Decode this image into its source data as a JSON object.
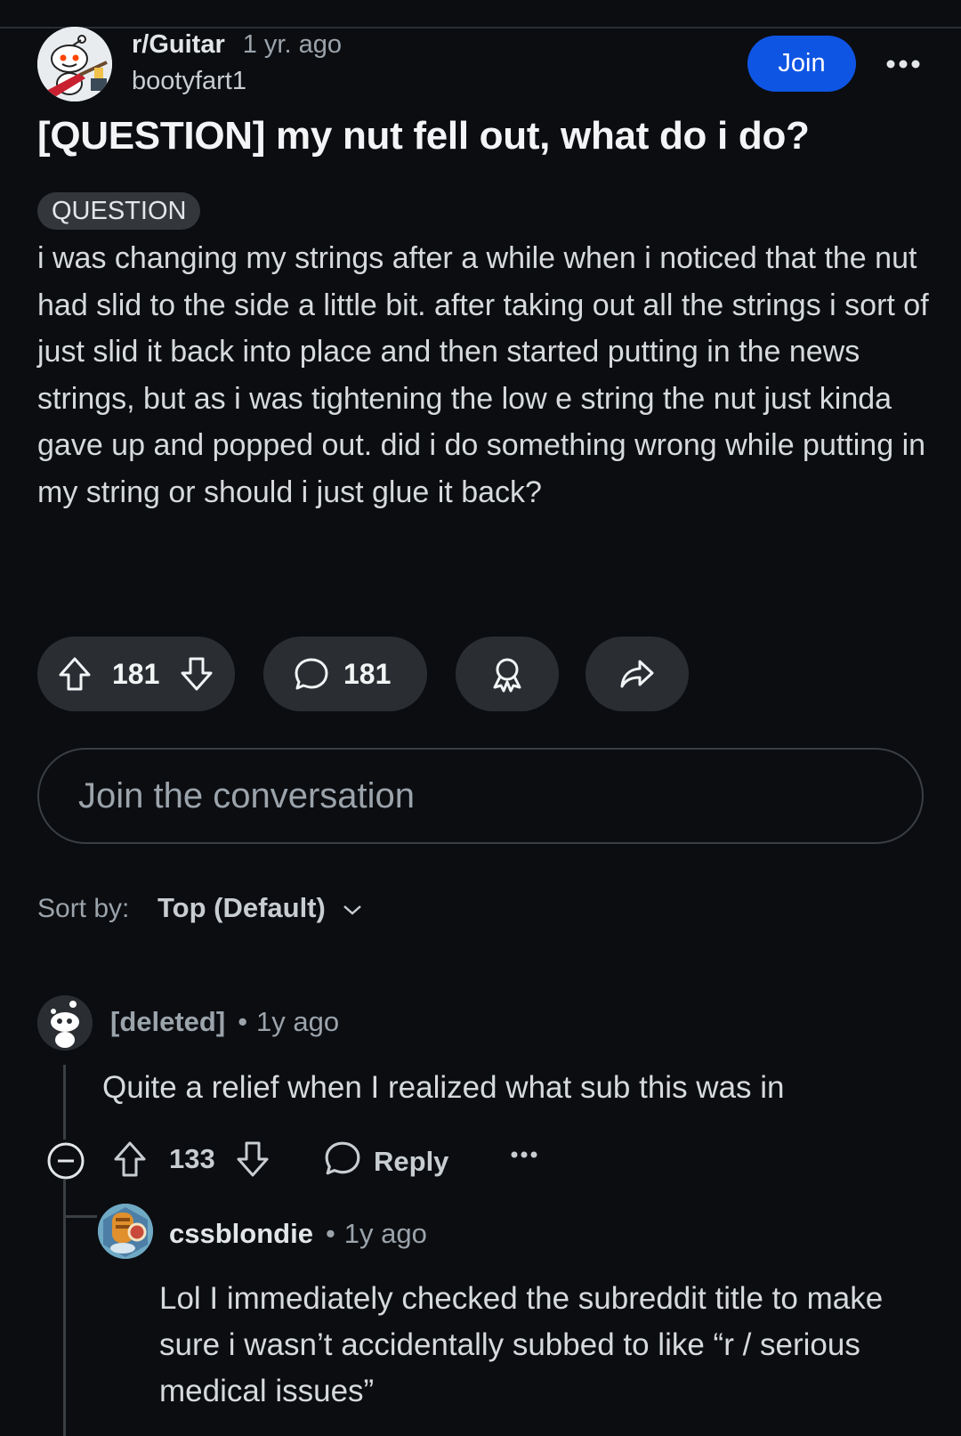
{
  "post": {
    "subreddit": "r/Guitar",
    "time": "1 yr. ago",
    "author": "bootyfart1",
    "join_label": "Join",
    "title": "[QUESTION] my nut fell out, what do i do?",
    "flair": "QUESTION",
    "body": "i was changing my strings after a while when i noticed that the nut had slid to the side a little bit. after taking out all the strings i sort of just slid it back into place and then started putting in the news strings, but as i was tightening the low e string the nut just kinda gave up and popped out. did i do something wrong while putting in my string or should i just glue it back?",
    "votes": "181",
    "comments": "181",
    "icons": [
      "upvote-icon",
      "downvote-icon",
      "comment-icon",
      "award-icon",
      "share-icon",
      "more-icon"
    ]
  },
  "composer": {
    "placeholder": "Join the conversation"
  },
  "sort": {
    "label": "Sort by:",
    "value": "Top (Default)"
  },
  "comments": [
    {
      "author": "[deleted]",
      "time": "1y ago",
      "body": "Quite a relief when I realized what sub this was in",
      "votes": "133",
      "reply_label": "Reply"
    },
    {
      "author": "cssblondie",
      "time": "1y ago",
      "body": "Lol I immediately checked the subreddit title to make sure i wasn’t accidentally subbed to like “r / serious medical issues”"
    }
  ],
  "colors": {
    "background": "#0b0d11",
    "join_button": "#0f55e4",
    "pill": "#2a2e33"
  }
}
